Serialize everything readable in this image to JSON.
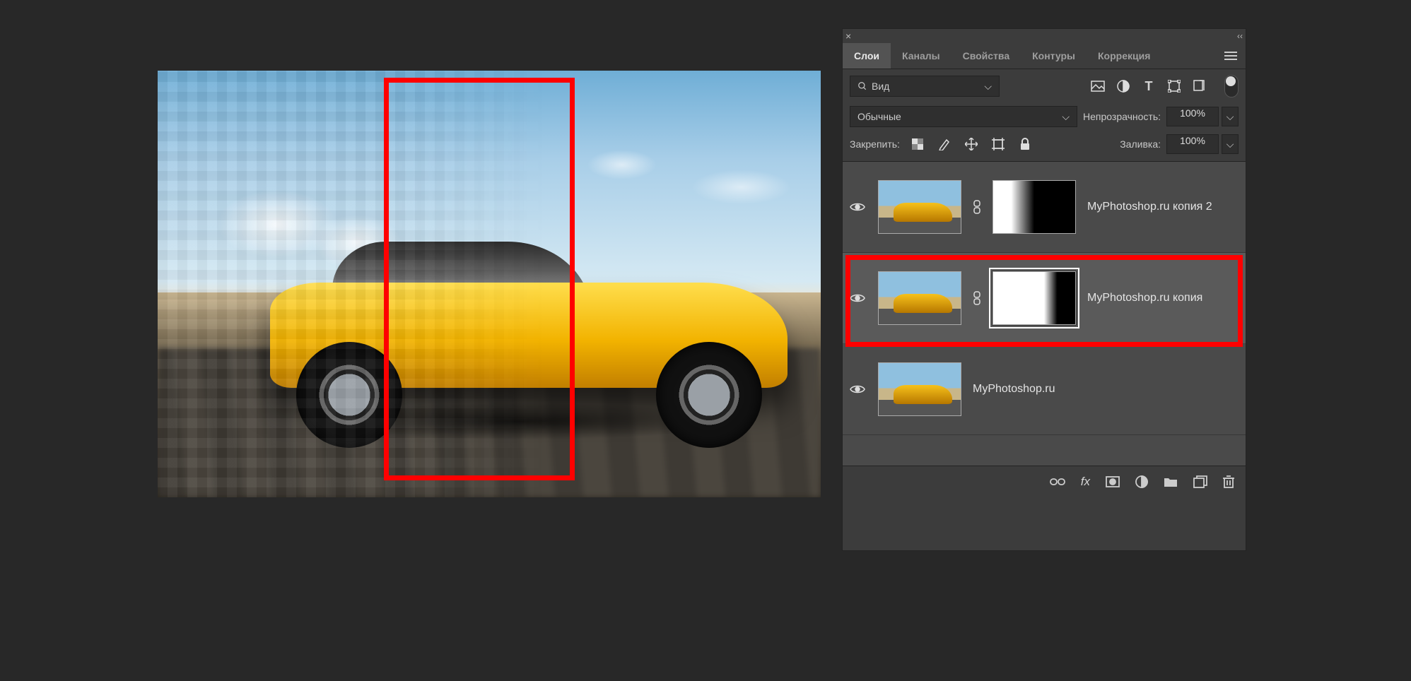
{
  "tabs": {
    "layers": "Слои",
    "channels": "Каналы",
    "properties": "Свойства",
    "paths": "Контуры",
    "adjustments": "Коррекция"
  },
  "filter": {
    "kind_label": "Вид"
  },
  "blend": {
    "mode": "Обычные",
    "opacity_label": "Непрозрачность:",
    "opacity_value": "100%"
  },
  "lock": {
    "label": "Закрепить:",
    "fill_label": "Заливка:",
    "fill_value": "100%"
  },
  "layers_list": [
    {
      "name": "MyPhotoshop.ru копия 2",
      "mask": "g1"
    },
    {
      "name": "MyPhotoshop.ru копия",
      "mask": "g2",
      "mask_selected": true
    },
    {
      "name": "MyPhotoshop.ru",
      "mask": null
    }
  ],
  "bottom_icons": {
    "link": "link-icon",
    "fx": "fx",
    "mask": "add-mask-icon",
    "adjust": "adjustment-icon",
    "group": "group-icon",
    "new": "new-layer-icon",
    "trash": "trash-icon"
  }
}
